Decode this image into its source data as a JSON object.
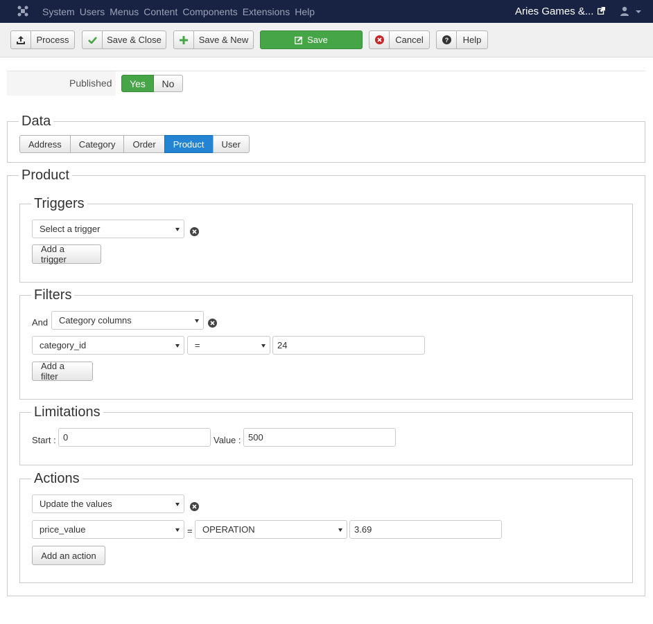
{
  "navbar": {
    "menu": [
      "System",
      "Users",
      "Menus",
      "Content",
      "Components",
      "Extensions",
      "Help"
    ],
    "site_name": "Aries Games &...",
    "logo_icon": "joomla-logo-icon",
    "external_icon": "external-link-icon",
    "user_icon": "user-icon"
  },
  "toolbar": {
    "process": "Process",
    "save_close": "Save & Close",
    "save_new": "Save & New",
    "save": "Save",
    "cancel": "Cancel",
    "help": "Help"
  },
  "published": {
    "label": "Published",
    "yes": "Yes",
    "no": "No",
    "selected": "Yes"
  },
  "data_section": {
    "legend": "Data",
    "tabs": [
      "Address",
      "Category",
      "Order",
      "Product",
      "User"
    ],
    "active": "Product"
  },
  "product_section": {
    "legend": "Product",
    "triggers": {
      "legend": "Triggers",
      "select": "Select a trigger",
      "add_button": "Add a trigger"
    },
    "filters": {
      "legend": "Filters",
      "conjunction": "And",
      "type_select": "Category columns",
      "column_select": "category_id",
      "operator_select": "=",
      "value": "24",
      "add_button": "Add a filter"
    },
    "limitations": {
      "legend": "Limitations",
      "start_label": "Start :",
      "start_value": "0",
      "value_label": "Value :",
      "value_value": "500"
    },
    "actions": {
      "legend": "Actions",
      "type_select": "Update the values",
      "column_select": "price_value",
      "equals": "=",
      "operation_select": "OPERATION",
      "value": "3.69",
      "add_button": "Add an action"
    }
  },
  "colors": {
    "navbar_bg": "#182242",
    "success": "#46a546",
    "primary": "#2384d3"
  }
}
